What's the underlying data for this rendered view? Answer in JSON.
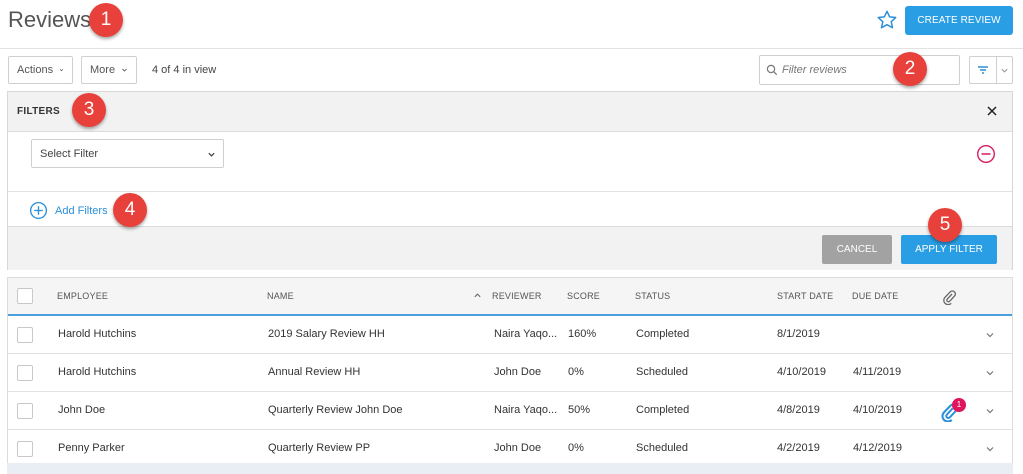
{
  "header": {
    "title": "Reviews",
    "create_label": "CREATE REVIEW"
  },
  "toolbar": {
    "actions_label": "Actions",
    "more_label": "More",
    "in_view": "4 of 4 in view",
    "search_placeholder": "Filter reviews"
  },
  "filters": {
    "title": "FILTERS",
    "select_placeholder": "Select Filter",
    "add_label": "Add Filters",
    "cancel_label": "CANCEL",
    "apply_label": "APPLY FILTER"
  },
  "callouts": [
    "1",
    "2",
    "3",
    "4",
    "5"
  ],
  "table": {
    "columns": {
      "employee": "EMPLOYEE",
      "name": "NAME",
      "reviewer": "REVIEWER",
      "score": "SCORE",
      "status": "STATUS",
      "start": "START DATE",
      "due": "DUE DATE"
    },
    "rows": [
      {
        "employee": "Harold Hutchins",
        "name": "2019 Salary Review HH",
        "reviewer": "Naira Yaqo...",
        "score": "160%",
        "status": "Completed",
        "start": "8/1/2019",
        "due": "",
        "attachments": ""
      },
      {
        "employee": "Harold Hutchins",
        "name": "Annual Review HH",
        "reviewer": "John Doe",
        "score": "0%",
        "status": "Scheduled",
        "start": "4/10/2019",
        "due": "4/11/2019",
        "attachments": ""
      },
      {
        "employee": "John Doe",
        "name": "Quarterly Review John Doe",
        "reviewer": "Naira Yaqo...",
        "score": "50%",
        "status": "Completed",
        "start": "4/8/2019",
        "due": "4/10/2019",
        "attachments": "1"
      },
      {
        "employee": "Penny Parker",
        "name": "Quarterly Review PP",
        "reviewer": "John Doe",
        "score": "0%",
        "status": "Scheduled",
        "start": "4/2/2019",
        "due": "4/12/2019",
        "attachments": ""
      }
    ]
  },
  "colors": {
    "accent": "#2a9ee4",
    "callout": "#e8413b",
    "remove": "#d81b60",
    "badge": "#e0135e"
  }
}
